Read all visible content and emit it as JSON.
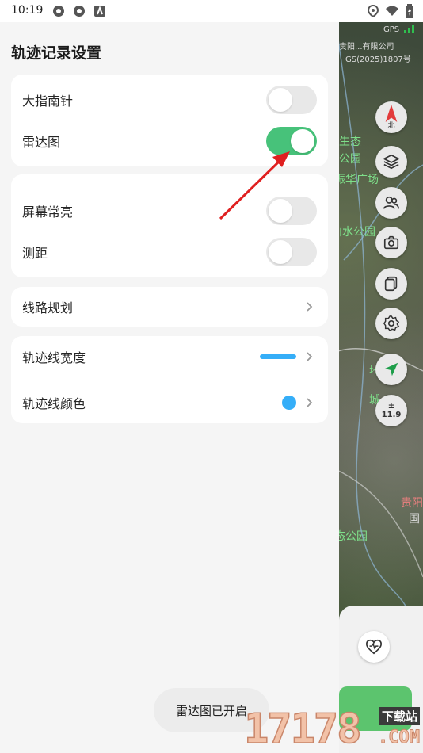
{
  "status_bar": {
    "time": "10:19",
    "left_icons": [
      "sync-icon",
      "sync-icon",
      "app-notification-icon"
    ],
    "right_icons": [
      "location-icon",
      "wifi-icon",
      "battery-icon"
    ]
  },
  "map": {
    "gps_label": "GPS",
    "labels": {
      "company_line1": "贵阳...有限公司",
      "company_line2": "GS(2025)1807号",
      "ecology": "生态",
      "park1": "公园",
      "plaza": "振华广场",
      "shanshui": "山水公园",
      "ring1": "环",
      "ring2": "城",
      "gui": "贵阳",
      "guo": "国",
      "park2": "态公园"
    },
    "compass_label": "北",
    "zoom_level": "11.9",
    "zoom_symbol": "±"
  },
  "panel": {
    "title": "轨迹记录设置",
    "group1": [
      {
        "label": "大指南针",
        "on": false
      },
      {
        "label": "雷达图",
        "on": true
      }
    ],
    "group2": [
      {
        "label": "屏幕常亮",
        "on": false
      },
      {
        "label": "测距",
        "on": false
      }
    ],
    "route_planning": "线路规划",
    "track_width": "轨迹线宽度",
    "track_color": "轨迹线颜色",
    "track_color_value": "#35aef8"
  },
  "toast": "雷达图已开启",
  "watermark": {
    "number": "17178",
    "top": "下载站",
    "domain": ".COM"
  },
  "colors": {
    "accent_green": "#47c27a",
    "accent_blue": "#35aef8",
    "arrow_red": "#e02020"
  }
}
